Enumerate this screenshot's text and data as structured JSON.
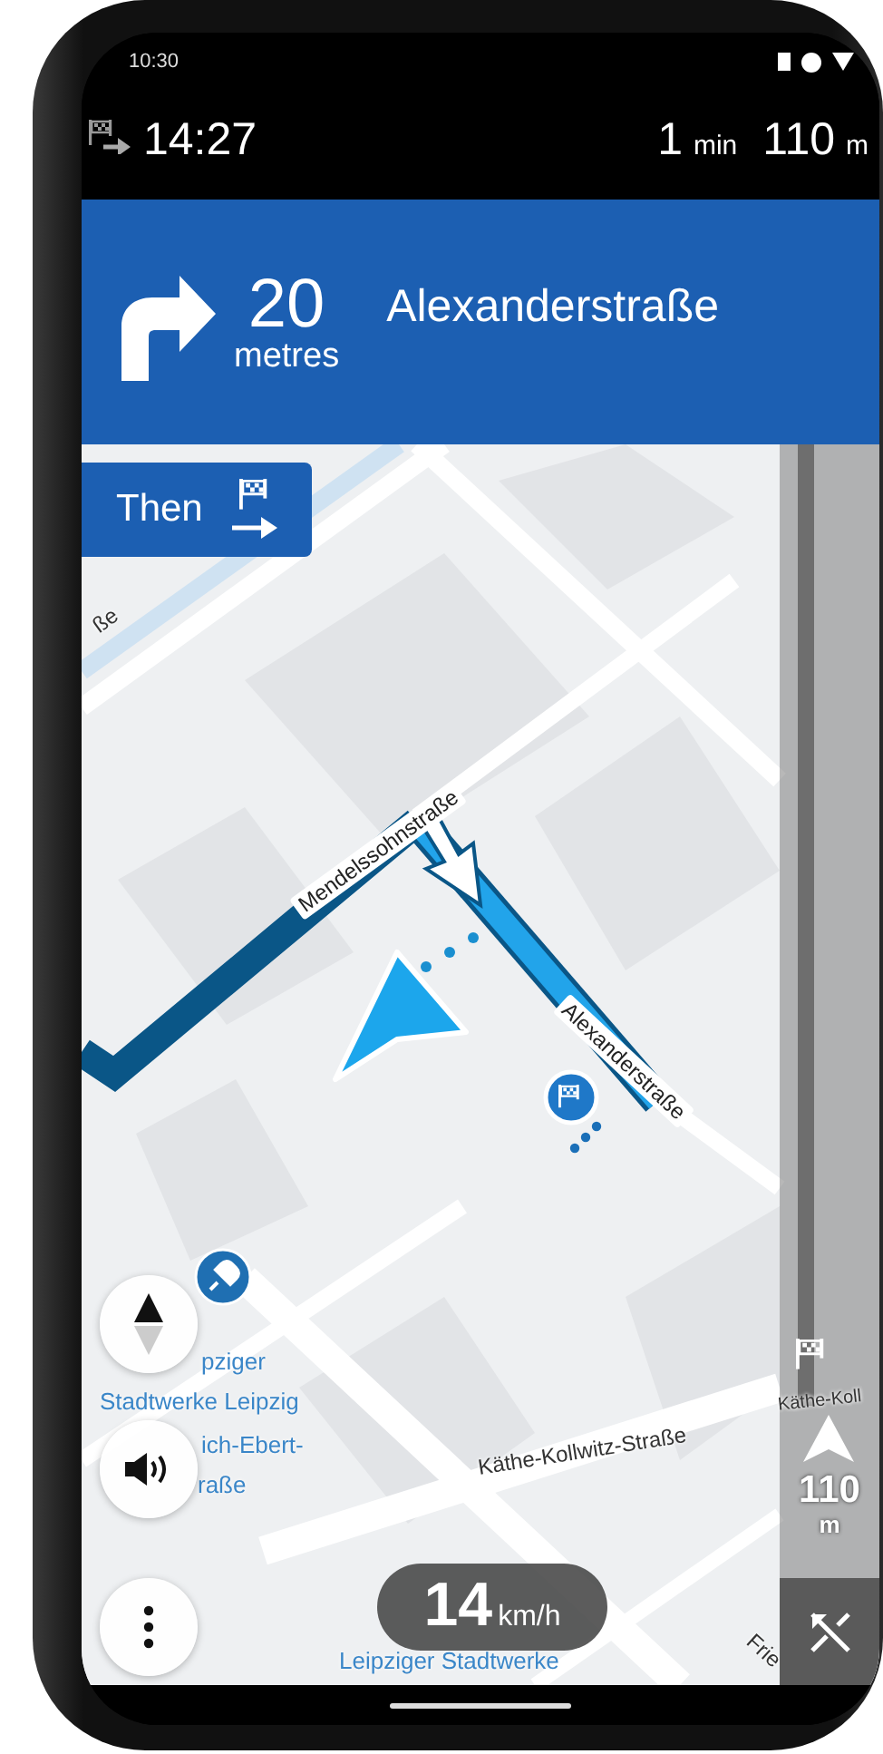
{
  "status_bar": {
    "time": "10:30"
  },
  "trip": {
    "arrival_time": "14:27",
    "remaining_time": "1",
    "remaining_time_unit": "min",
    "remaining_distance": "110",
    "remaining_distance_unit": "m"
  },
  "instruction": {
    "distance": "20",
    "distance_unit": "metres",
    "street": "Alexanderstraße"
  },
  "next_instruction": {
    "label": "Then"
  },
  "map": {
    "labels": [
      {
        "text": "ße",
        "kind": "street"
      },
      {
        "text": "Mendelssohnstraße",
        "kind": "route-street"
      },
      {
        "text": "Alexanderstraße",
        "kind": "route-street"
      },
      {
        "text": "pziger",
        "kind": "poi"
      },
      {
        "text": "Stadtwerke Leipzig",
        "kind": "poi"
      },
      {
        "text": "ich-Ebert-",
        "kind": "poi"
      },
      {
        "text": "raße",
        "kind": "poi"
      },
      {
        "text": "Käthe-Kollwitz-Straße",
        "kind": "street"
      },
      {
        "text": "Käthe-Koll",
        "kind": "street"
      },
      {
        "text": "Frie",
        "kind": "street"
      },
      {
        "text": "Leipziger Stadtwerke",
        "kind": "poi"
      }
    ]
  },
  "map_controls": [
    {
      "kind": "compass"
    },
    {
      "kind": "sound"
    },
    {
      "kind": "more"
    }
  ],
  "route_bar": {
    "distance": "110",
    "unit": "m"
  },
  "speed": {
    "value": "14",
    "unit": "km/h"
  }
}
